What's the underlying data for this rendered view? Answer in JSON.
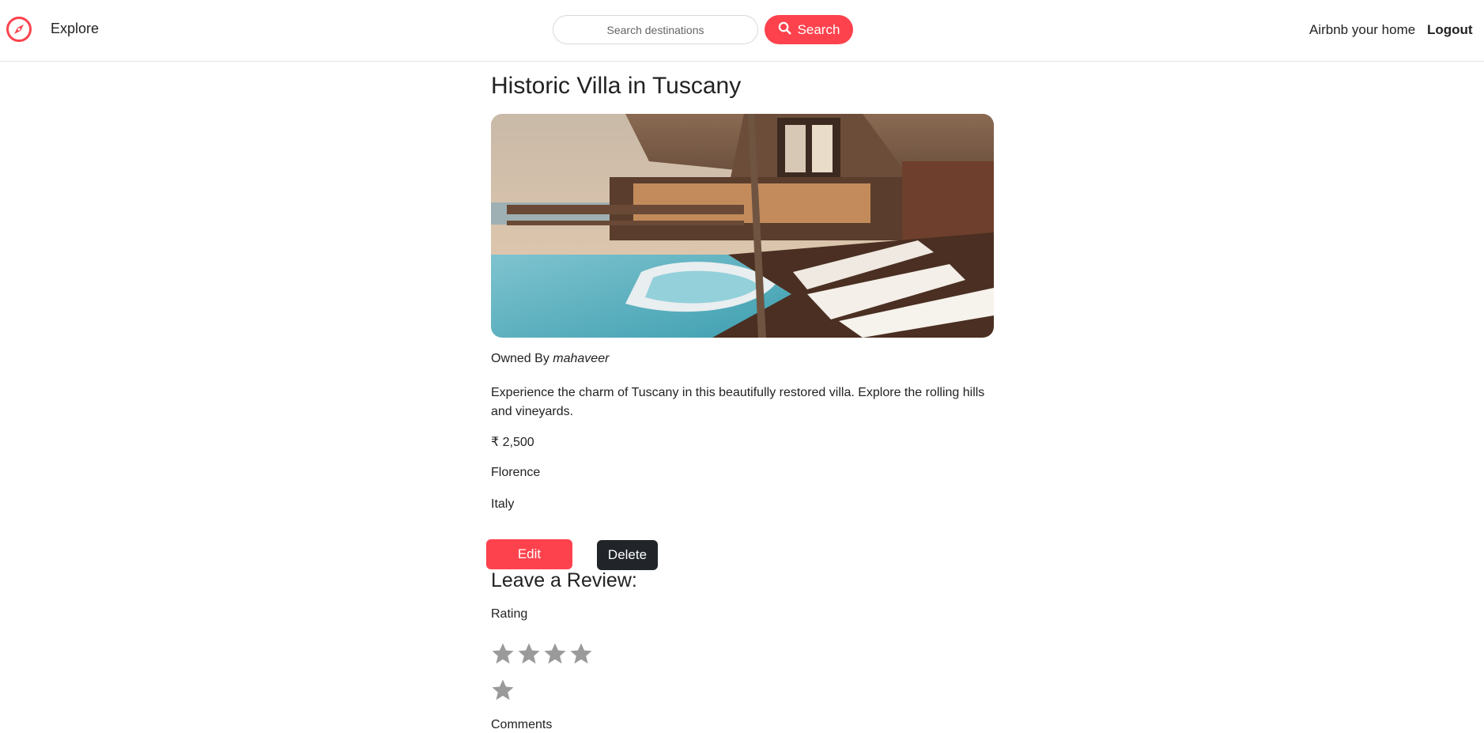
{
  "navbar": {
    "brand_icon": "compass-icon",
    "explore_label": "Explore",
    "search_placeholder": "Search destinations",
    "search_value": "",
    "search_button_label": "Search",
    "search_icon": "search-icon",
    "host_label": "Airbnb your home",
    "logout_label": "Logout"
  },
  "listing": {
    "title": "Historic Villa in Tuscany",
    "owner_prefix": "Owned By",
    "owner_name": "mahaveer",
    "description": "Experience the charm of Tuscany in this beautifully restored villa. Explore the rolling hills and vineyards.",
    "price": "₹ 2,500",
    "location": "Florence",
    "country": "Italy",
    "edit_label": "Edit",
    "delete_label": "Delete"
  },
  "review": {
    "heading": "Leave a Review:",
    "rating_label": "Rating",
    "star_count": 5,
    "star_icon": "star-icon",
    "comments_label": "Comments"
  },
  "colors": {
    "accent": "#fe424d",
    "dark_button": "#212529",
    "star_gray": "#9a9a9a",
    "text": "#222222"
  }
}
